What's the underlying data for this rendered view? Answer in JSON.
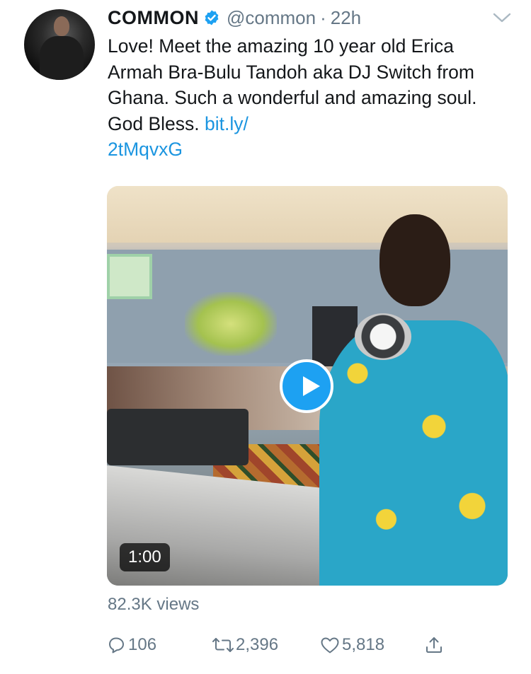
{
  "tweet": {
    "author_name": "COMMON",
    "handle": "@common",
    "separator": "·",
    "time": "22h",
    "text_body": "Love! Meet the amazing 10 year old Erica Armah Bra-Bulu Tandoh aka DJ Switch from Ghana. Such a wonderful and amazing soul. God Bless. ",
    "link_text": "bit.ly/\n2tMqvxG",
    "link_line1": "bit.ly/",
    "link_line2": "2tMqvxG"
  },
  "media": {
    "duration": "1:00"
  },
  "views": "82.3K views",
  "actions": {
    "reply_count": "106",
    "retweet_count": "2,396",
    "like_count": "5,818"
  },
  "colors": {
    "link": "#1b95e0",
    "muted": "#657786",
    "play_button": "#1da1f2",
    "verified": "#1da1f2"
  },
  "icons": [
    "verified-badge-icon",
    "chevron-down-icon",
    "play-icon",
    "reply-icon",
    "retweet-icon",
    "like-icon",
    "share-icon"
  ]
}
